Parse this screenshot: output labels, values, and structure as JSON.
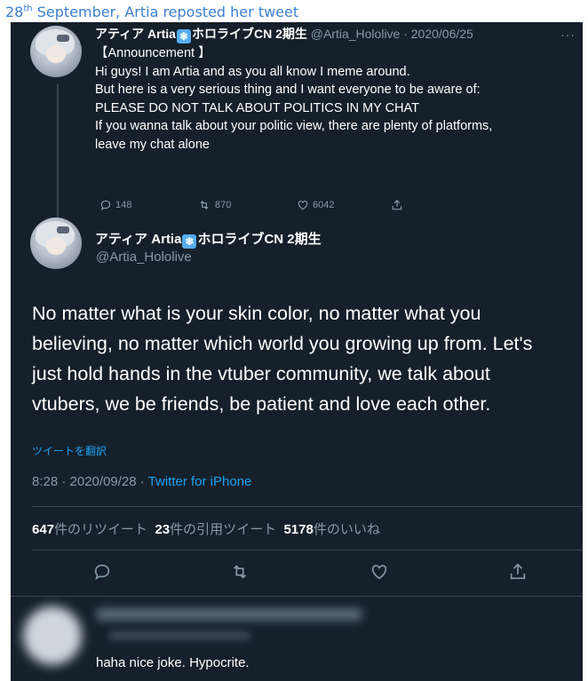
{
  "caption": {
    "prefix": "28",
    "ordinal": "th",
    "rest": " September, Artia reposted her tweet"
  },
  "first_tweet": {
    "display_name": "アティア Artia",
    "name_suffix": "ホロライブCN 2期生",
    "handle_date": "@Artia_Hololive · 2020/06/25",
    "lines": [
      "【Announcement 】",
      "Hi guys! I am Artia and as you all know I meme around.",
      "But here is a very serious thing and I want everyone to be aware of:",
      "PLEASE DO NOT TALK ABOUT POLITICS IN MY CHAT",
      "If you wanna talk about your politic view, there are plenty of platforms,",
      "leave my chat alone"
    ],
    "replies": "148",
    "retweets": "870",
    "likes": "6042"
  },
  "main_tweet": {
    "display_name": "アティア Artia",
    "name_suffix": "ホロライブCN 2期生",
    "handle": "@Artia_Hololive",
    "lines": [
      "No matter what is your skin color, no matter what you",
      "believing, no matter which world you growing up from. Let's",
      "just hold hands in the vtuber community, we talk about",
      "vtubers, we be friends, be patient and love each other."
    ],
    "translate": "ツイートを翻訳",
    "time_date": "8:28 · 2020/09/28 · ",
    "via": "Twitter for iPhone",
    "retweets_count": "647",
    "retweets_label": "件のリツイート",
    "quotes_count": "23",
    "quotes_label": "件の引用ツイート",
    "likes_count": "5178",
    "likes_label": "件のいいね"
  },
  "reply": {
    "text": "haha nice joke. Hypocrite."
  },
  "colors": {
    "background": "#15202b",
    "accent": "#1da1f2",
    "muted": "#8899a6",
    "caption": "#3b7fd1"
  }
}
